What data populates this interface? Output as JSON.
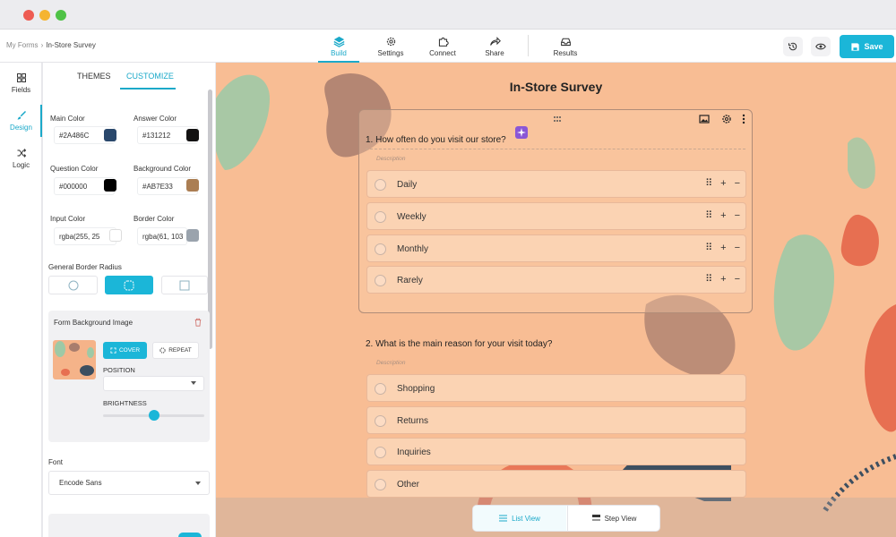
{
  "breadcrumb": {
    "root": "My Forms",
    "separator": "›",
    "current": "In-Store Survey"
  },
  "nav": {
    "tabs": [
      {
        "label": "Build",
        "icon": "layers-icon",
        "active": true
      },
      {
        "label": "Settings",
        "icon": "gear-icon",
        "active": false
      },
      {
        "label": "Connect",
        "icon": "puzzle-icon",
        "active": false
      },
      {
        "label": "Share",
        "icon": "share-icon",
        "active": false
      }
    ],
    "results": {
      "label": "Results",
      "icon": "inbox-icon"
    }
  },
  "header_actions": {
    "history_icon": "history-icon",
    "preview_icon": "eye-icon",
    "save_label": "Save"
  },
  "rail": [
    {
      "label": "Fields",
      "icon": "grid-icon",
      "active": false
    },
    {
      "label": "Design",
      "icon": "brush-icon",
      "active": true
    },
    {
      "label": "Logic",
      "icon": "shuffle-icon",
      "active": false
    }
  ],
  "panel": {
    "tabs": {
      "themes": "THEMES",
      "customize": "CUSTOMIZE",
      "active": "CUSTOMIZE"
    },
    "colors": [
      {
        "label": "Main Color",
        "value": "#2A486C",
        "swatch": "#2A486C"
      },
      {
        "label": "Answer Color",
        "value": "#131212",
        "swatch": "#131212"
      },
      {
        "label": "Question Color",
        "value": "#000000",
        "swatch": "#000000"
      },
      {
        "label": "Background Color",
        "value": "#AB7E33",
        "swatch": "#AB7E53"
      },
      {
        "label": "Input Color",
        "value": "rgba(255, 25",
        "swatch": "#ffffff"
      },
      {
        "label": "Border Color",
        "value": "rgba(61, 103",
        "swatch": "#9aa3ad"
      }
    ],
    "border_radius": {
      "label": "General Border Radius",
      "selected_index": 1
    },
    "bg_image": {
      "title": "Form Background Image",
      "cover_label": "COVER",
      "repeat_label": "REPEAT",
      "position_label": "POSITION",
      "brightness_label": "BRIGHTNESS",
      "brightness": 0.5
    },
    "font": {
      "label": "Font",
      "value": "Encode Sans"
    }
  },
  "form": {
    "title": "In-Store Survey",
    "questions": [
      {
        "text": "1. How often do you visit our store?",
        "description": "Description",
        "options": [
          "Daily",
          "Weekly",
          "Monthly",
          "Rarely"
        ]
      },
      {
        "text": "2. What is the main reason for your visit today?",
        "description": "Description",
        "options": [
          "Shopping",
          "Returns",
          "Inquiries",
          "Other"
        ]
      }
    ]
  },
  "view_switch": {
    "list": "List View",
    "step": "Step View",
    "active": "List View"
  },
  "colors": {
    "accent": "#1BB6D8",
    "canvas_bg": "#F8BD94",
    "ai_badge": "#8A57D6"
  }
}
